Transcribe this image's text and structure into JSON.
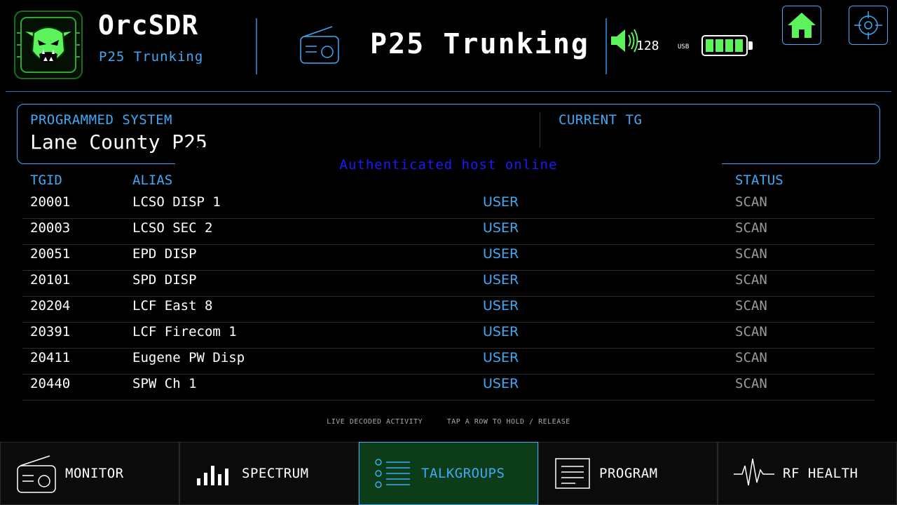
{
  "header": {
    "app_title": "OrcSDR",
    "app_subtitle": "P25 Trunking",
    "mode_title": "P25 Trunking",
    "volume": "128",
    "usb_label": "USB",
    "battery_bars": 4
  },
  "system": {
    "label": "PROGRAMMED SYSTEM",
    "value": "Lane County P25",
    "current_tg_label": "CURRENT TG"
  },
  "toast": "Authenticated host online",
  "table": {
    "headers": [
      "TGID",
      "ALIAS",
      "STATUS"
    ],
    "rows": [
      {
        "tgid": "20001",
        "alias": "LCSO DISP 1",
        "type": "USER",
        "status": "SCAN"
      },
      {
        "tgid": "20003",
        "alias": "LCSO SEC 2",
        "type": "USER",
        "status": "SCAN"
      },
      {
        "tgid": "20051",
        "alias": "EPD DISP",
        "type": "USER",
        "status": "SCAN"
      },
      {
        "tgid": "20101",
        "alias": "SPD DISP",
        "type": "USER",
        "status": "SCAN"
      },
      {
        "tgid": "20204",
        "alias": "LCF East 8",
        "type": "USER",
        "status": "SCAN"
      },
      {
        "tgid": "20391",
        "alias": "LCF Firecom 1",
        "type": "USER",
        "status": "SCAN"
      },
      {
        "tgid": "20411",
        "alias": "Eugene PW Disp",
        "type": "USER",
        "status": "SCAN"
      },
      {
        "tgid": "20440",
        "alias": "SPW Ch 1",
        "type": "USER",
        "status": "SCAN"
      }
    ]
  },
  "footer": {
    "hint_left": "LIVE DECODED ACTIVITY",
    "hint_right": "TAP A ROW TO HOLD / RELEASE"
  },
  "nav": {
    "items": [
      {
        "label": "MONITOR",
        "icon": "radio-icon"
      },
      {
        "label": "SPECTRUM",
        "icon": "bars-icon"
      },
      {
        "label": "TALKGROUPS",
        "icon": "list-icon",
        "active": true
      },
      {
        "label": "PROGRAM",
        "icon": "document-icon"
      },
      {
        "label": "RF HEALTH",
        "icon": "pulse-icon"
      }
    ]
  },
  "colors": {
    "accent_blue": "#3fa9f5",
    "accent_green": "#5cf25c",
    "toast_text": "#1a1aff",
    "active_nav_bg": "#0d3d18"
  }
}
